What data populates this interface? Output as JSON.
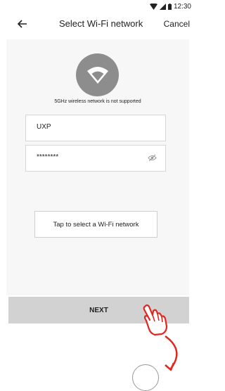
{
  "status": {
    "time": "12:30"
  },
  "header": {
    "title": "Select Wi-Fi network",
    "cancel_label": "Cancel"
  },
  "notice": "5GHz wireless network  is not supported",
  "network": {
    "ssid": "UXP",
    "password_masked": "********"
  },
  "select_button_label": "Tap to select a Wi-Fi network",
  "next_label": "NEXT",
  "icons": {
    "back": "arrow-left-icon",
    "wifi": "wifi-icon",
    "eye": "eye-off-icon",
    "hand": "hand-pointer-icon"
  },
  "colors": {
    "wifi_circle": "#8d8d8d",
    "next_button": "#d2d2d2",
    "hint_red": "#e3261e"
  }
}
